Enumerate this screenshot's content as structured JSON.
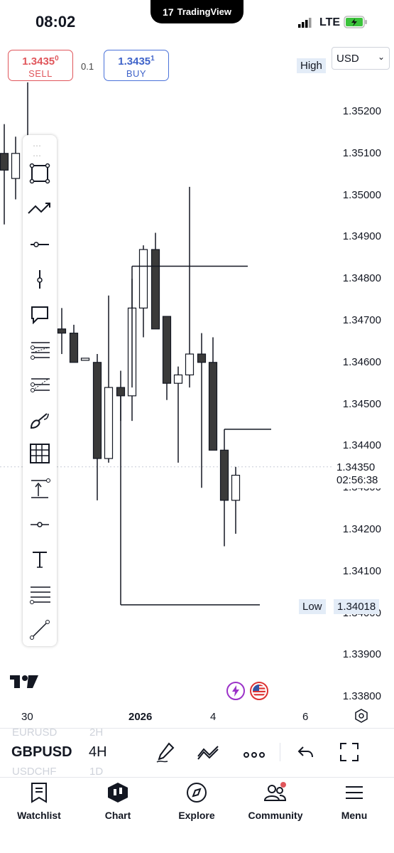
{
  "status_bar": {
    "time": "08:02",
    "app_pill": "TradingView",
    "network": "LTE"
  },
  "order": {
    "sell_price_main": "1.3435",
    "sell_price_sup": "0",
    "sell_label": "SELL",
    "spread": "0.1",
    "buy_price_main": "1.3435",
    "buy_price_sup": "1",
    "buy_label": "BUY"
  },
  "currency": "USD",
  "high_label": "High",
  "low_label": "Low",
  "low_price": "1.34018",
  "current_price": "1.34350",
  "countdown": "02:56:38",
  "price_axis": [
    "1.35200",
    "1.35100",
    "1.35000",
    "1.34900",
    "1.34800",
    "1.34700",
    "1.34600",
    "1.34500",
    "1.34400",
    "1.34300",
    "1.34200",
    "1.34100",
    "1.34000",
    "1.33900",
    "1.33800"
  ],
  "x_axis": [
    "30",
    "2026",
    "4",
    "6"
  ],
  "tools": [
    "rectangle-tool",
    "trend-path-tool",
    "horizontal-line-tool",
    "vertical-line-tool",
    "callout-tool",
    "fib-retracement-tool",
    "fib-extension-tool",
    "brush-tool",
    "grid-tool",
    "long-position-tool",
    "ray-point-tool",
    "text-tool",
    "multiple-lines-tool",
    "trend-line-tool"
  ],
  "symbol": {
    "name": "GBPUSD",
    "interval": "4H",
    "prev_symbol": "EURUSD",
    "prev_interval": "2H",
    "next_symbol": "USDCHF",
    "next_interval": "1D"
  },
  "bottom_nav": [
    {
      "label": "Watchlist",
      "icon": "watchlist-icon"
    },
    {
      "label": "Chart",
      "icon": "chart-icon"
    },
    {
      "label": "Explore",
      "icon": "compass-icon"
    },
    {
      "label": "Community",
      "icon": "community-icon"
    },
    {
      "label": "Menu",
      "icon": "menu-icon"
    }
  ],
  "colors": {
    "sell": "#e0565b",
    "buy": "#3f63c9",
    "bear_candle": "#3a3a3a",
    "bull_candle": "#ffffff",
    "price_tag_bg": "#e3ecf7",
    "lightning": "#9b32c8"
  },
  "candles": [
    {
      "o": 1.351,
      "h": 1.3517,
      "l": 1.3493,
      "c": 1.3506
    },
    {
      "o": 1.3504,
      "h": 1.3514,
      "l": 1.3499,
      "c": 1.351
    },
    {
      "o": 1.3512,
      "h": 1.3527,
      "l": 1.35,
      "c": 1.3513
    },
    {
      "o": 1.3468,
      "h": 1.3473,
      "l": 1.3462,
      "c": 1.3467
    },
    {
      "o": 1.3467,
      "h": 1.3469,
      "l": 1.346,
      "c": 1.346
    },
    {
      "o": 1.3461,
      "h": 1.3461,
      "l": 1.3461,
      "c": 1.3461
    },
    {
      "o": 1.346,
      "h": 1.3462,
      "l": 1.3427,
      "c": 1.3437
    },
    {
      "o": 1.3437,
      "h": 1.3476,
      "l": 1.3436,
      "c": 1.3454
    },
    {
      "o": 1.3454,
      "h": 1.3458,
      "l": 1.3446,
      "c": 1.3452
    },
    {
      "o": 1.3452,
      "h": 1.348,
      "l": 1.3446,
      "c": 1.3473
    },
    {
      "o": 1.3473,
      "h": 1.3488,
      "l": 1.3466,
      "c": 1.3487
    },
    {
      "o": 1.3487,
      "h": 1.3491,
      "l": 1.3468,
      "c": 1.3468
    },
    {
      "o": 1.3471,
      "h": 1.3471,
      "l": 1.3451,
      "c": 1.3455
    },
    {
      "o": 1.3455,
      "h": 1.3459,
      "l": 1.3436,
      "c": 1.3457
    },
    {
      "o": 1.3457,
      "h": 1.3502,
      "l": 1.3454,
      "c": 1.3462
    },
    {
      "o": 1.3462,
      "h": 1.3467,
      "l": 1.343,
      "c": 1.346
    },
    {
      "o": 1.346,
      "h": 1.3466,
      "l": 1.3439,
      "c": 1.3439
    },
    {
      "o": 1.3439,
      "h": 1.3439,
      "l": 1.3416,
      "c": 1.3427
    },
    {
      "o": 1.3427,
      "h": 1.3435,
      "l": 1.3419,
      "c": 1.3433
    }
  ],
  "drawn_levels": [
    1.3483,
    1.3444,
    1.3402
  ]
}
